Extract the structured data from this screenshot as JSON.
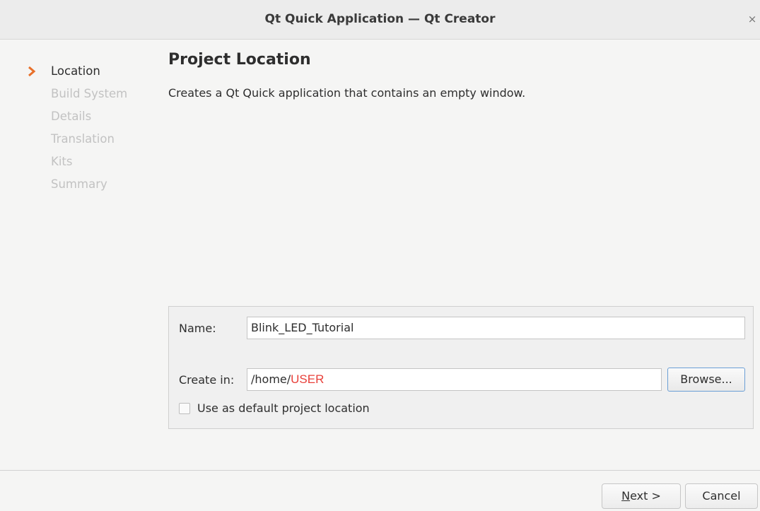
{
  "window": {
    "title": "Qt Quick Application — Qt Creator",
    "close_label": "×"
  },
  "sidebar": {
    "steps": [
      {
        "label": "Location",
        "current": true
      },
      {
        "label": "Build System",
        "current": false
      },
      {
        "label": "Details",
        "current": false
      },
      {
        "label": "Translation",
        "current": false
      },
      {
        "label": "Kits",
        "current": false
      },
      {
        "label": "Summary",
        "current": false
      }
    ],
    "arrow_color": "#e8702a"
  },
  "main": {
    "heading": "Project Location",
    "description": "Creates a Qt Quick application that contains an empty window."
  },
  "form": {
    "name_label": "Name:",
    "name_value": "Blink_LED_Tutorial",
    "create_in_label": "Create in:",
    "create_in_prefix": "/home/",
    "create_in_user": "USER",
    "browse_label": "Browse...",
    "default_location_label": "Use as default project location",
    "default_location_checked": false
  },
  "footer": {
    "next_mnemonic": "N",
    "next_rest": "ext >",
    "cancel_label": "Cancel"
  },
  "colors": {
    "user_highlight": "#e8403a",
    "focus_border": "#6b9fd6"
  }
}
